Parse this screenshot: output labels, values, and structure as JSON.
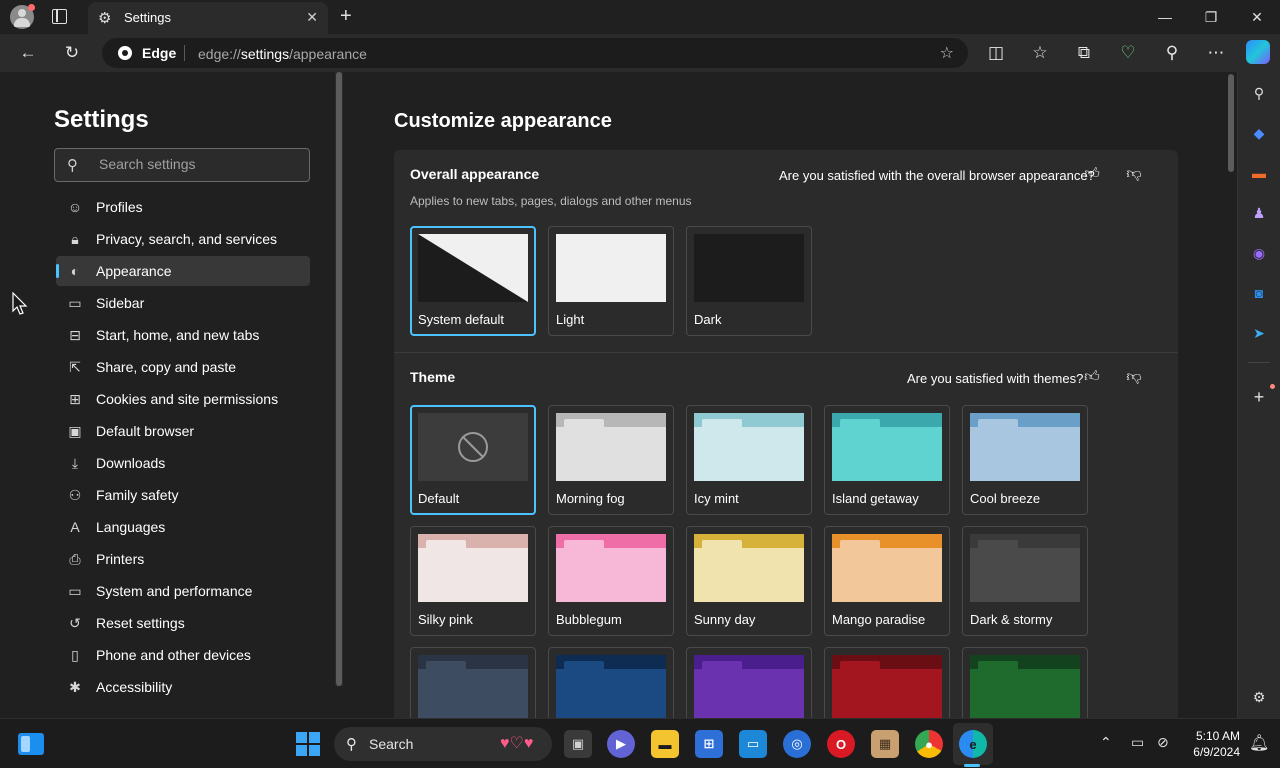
{
  "browser": {
    "tab_title": "Settings",
    "omnibox": {
      "brand": "Edge",
      "url_prefix": "edge://",
      "url_host": "settings",
      "url_path": "/appearance"
    }
  },
  "settings_nav": {
    "title": "Settings",
    "search_placeholder": "Search settings",
    "items": [
      {
        "label": "Profiles",
        "icon": "profile-icon"
      },
      {
        "label": "Privacy, search, and services",
        "icon": "lock-icon"
      },
      {
        "label": "Appearance",
        "icon": "palette-icon",
        "active": true
      },
      {
        "label": "Sidebar",
        "icon": "sidebar-icon"
      },
      {
        "label": "Start, home, and new tabs",
        "icon": "home-tabs-icon"
      },
      {
        "label": "Share, copy and paste",
        "icon": "share-icon"
      },
      {
        "label": "Cookies and site permissions",
        "icon": "cookie-icon"
      },
      {
        "label": "Default browser",
        "icon": "browser-icon"
      },
      {
        "label": "Downloads",
        "icon": "download-icon"
      },
      {
        "label": "Family safety",
        "icon": "family-icon"
      },
      {
        "label": "Languages",
        "icon": "language-icon"
      },
      {
        "label": "Printers",
        "icon": "printer-icon"
      },
      {
        "label": "System and performance",
        "icon": "laptop-icon"
      },
      {
        "label": "Reset settings",
        "icon": "reset-icon"
      },
      {
        "label": "Phone and other devices",
        "icon": "phone-icon"
      },
      {
        "label": "Accessibility",
        "icon": "accessibility-icon"
      }
    ]
  },
  "main": {
    "title": "Customize appearance",
    "overall": {
      "title": "Overall appearance",
      "subtitle": "Applies to new tabs, pages, dialogs and other menus",
      "feedback": "Are you satisfied with the overall browser appearance?",
      "options": [
        {
          "label": "System default",
          "selected": true
        },
        {
          "label": "Light",
          "selected": false
        },
        {
          "label": "Dark",
          "selected": false
        }
      ]
    },
    "theme": {
      "title": "Theme",
      "feedback": "Are you satisfied with themes?",
      "themes": [
        {
          "label": "Default",
          "selected": true,
          "tab": "#3c3c3c",
          "body": "#3c3c3c"
        },
        {
          "label": "Morning fog",
          "tab": "#b7b7b7",
          "body": "#e0e0e0"
        },
        {
          "label": "Icy mint",
          "tab": "#8fc9d1",
          "body": "#cfe8ec"
        },
        {
          "label": "Island getaway",
          "tab": "#3aa8ad",
          "body": "#5ed3d0"
        },
        {
          "label": "Cool breeze",
          "tab": "#6aa0c8",
          "body": "#a9c6e0"
        },
        {
          "label": "Silky pink",
          "tab": "#d9b1ad",
          "body": "#f0e6e6"
        },
        {
          "label": "Bubblegum",
          "tab": "#f06ea8",
          "body": "#f6b8d6"
        },
        {
          "label": "Sunny day",
          "tab": "#d6b23a",
          "body": "#f0e3ae"
        },
        {
          "label": "Mango paradise",
          "tab": "#e8902a",
          "body": "#f2c79a"
        },
        {
          "label": "Dark & stormy",
          "tab": "#3a3a3a",
          "body": "#4a4a4a"
        },
        {
          "label": "",
          "tab": "#2a3444",
          "body": "#3e4c62"
        },
        {
          "label": "",
          "tab": "#0e2c52",
          "body": "#1b4a82"
        },
        {
          "label": "",
          "tab": "#4a1e8c",
          "body": "#6b32b0"
        },
        {
          "label": "",
          "tab": "#6b0e14",
          "body": "#a3151f"
        },
        {
          "label": "",
          "tab": "#13421f",
          "body": "#1f6b2e"
        }
      ]
    }
  },
  "taskbar": {
    "search_label": "Search",
    "time": "5:10 AM",
    "date": "6/9/2024"
  }
}
